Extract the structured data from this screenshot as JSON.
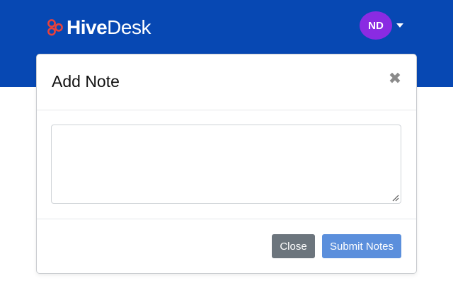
{
  "header": {
    "brand_bold": "Hive",
    "brand_light": "Desk",
    "brand_icon": "hive-logo-icon",
    "user_initials": "ND",
    "colors": {
      "topbar": "#0748b3",
      "avatar": "#8a2be2",
      "logo_icon": "#e8413b"
    }
  },
  "modal": {
    "title": "Add Note",
    "close_icon_glyph": "✖",
    "textarea_value": "",
    "textarea_placeholder": "",
    "buttons": {
      "close_label": "Close",
      "submit_label": "Submit Notes"
    },
    "colors": {
      "close_button": "#6c757d",
      "submit_button": "#5b8fdc"
    }
  }
}
